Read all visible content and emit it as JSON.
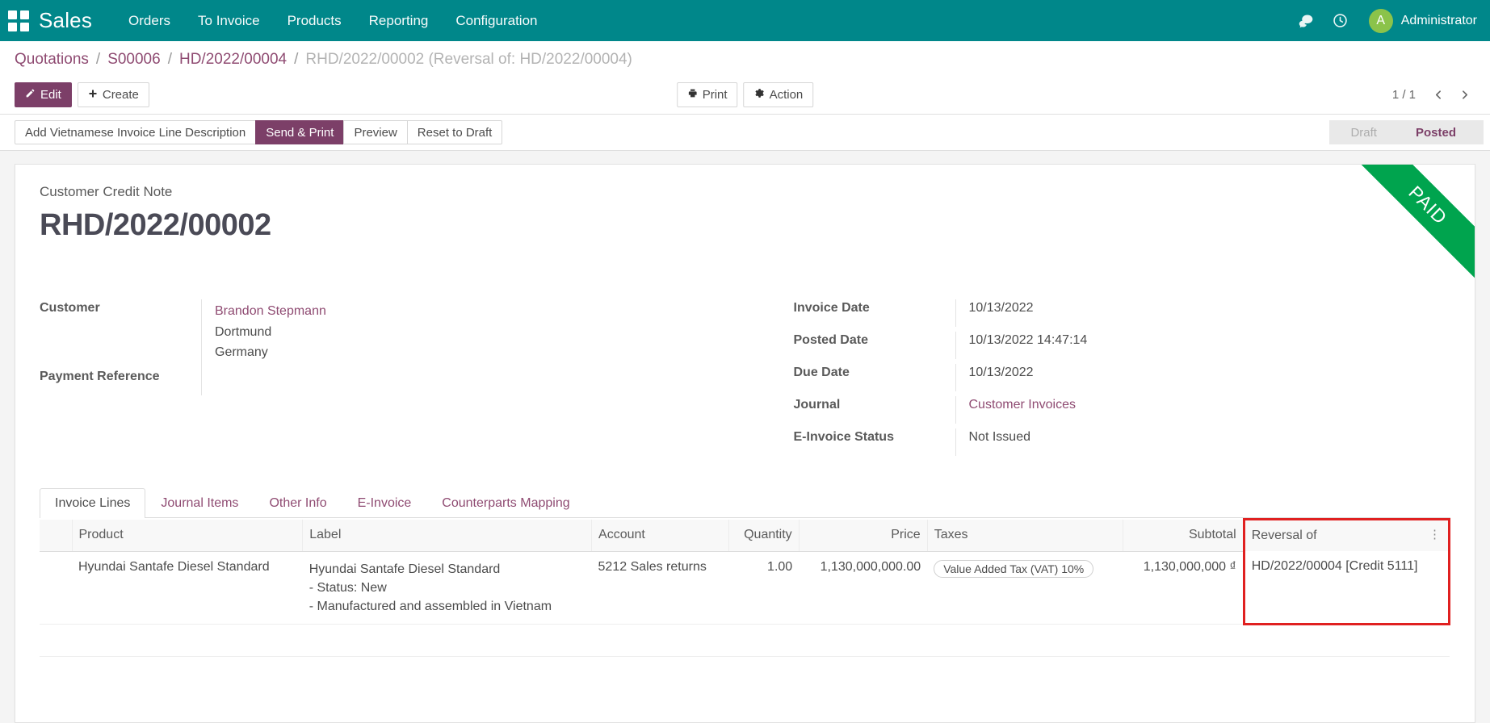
{
  "navbar": {
    "apps_icon": "apps-grid-icon",
    "brand": "Sales",
    "menu": [
      {
        "label": "Orders"
      },
      {
        "label": "To Invoice"
      },
      {
        "label": "Products"
      },
      {
        "label": "Reporting"
      },
      {
        "label": "Configuration"
      }
    ],
    "messages_icon": "messages-icon",
    "activities_icon": "clock-icon",
    "avatar_initial": "A",
    "user_name": "Administrator",
    "background_color": "#00878a",
    "avatar_color": "#8bc34a"
  },
  "breadcrumb": {
    "items": [
      {
        "label": "Quotations",
        "active": false
      },
      {
        "label": "S00006",
        "active": false
      },
      {
        "label": "HD/2022/00004",
        "active": false
      }
    ],
    "separator": "/",
    "current": "RHD/2022/00002 (Reversal of: HD/2022/00004)"
  },
  "controls": {
    "edit_label": "Edit",
    "create_label": "Create",
    "print_label": "Print",
    "action_label": "Action",
    "pager_value": "1 / 1",
    "prev_icon": "chevron-left-icon",
    "next_icon": "chevron-right-icon"
  },
  "statusbar_buttons": [
    {
      "label": "Add Vietnamese Invoice Line Description",
      "primary": false
    },
    {
      "label": "Send & Print",
      "primary": true
    },
    {
      "label": "Preview",
      "primary": false
    },
    {
      "label": "Reset to Draft",
      "primary": false
    }
  ],
  "statusbar": {
    "states": [
      {
        "label": "Draft",
        "active": false
      },
      {
        "label": "Posted",
        "active": true
      }
    ],
    "active_color": "#7c3f68"
  },
  "sheet": {
    "ribbon": "PAID",
    "ribbon_color": "#00a44e",
    "subtitle": "Customer Credit Note",
    "title": "RHD/2022/00002",
    "left_fields": [
      {
        "label": "Customer",
        "value_lines": [
          "Brandon Stepmann",
          "Dortmund",
          "Germany"
        ],
        "link_first": true
      },
      {
        "label": "Payment Reference",
        "value_lines": [],
        "link_first": false
      }
    ],
    "right_fields": [
      {
        "label": "Invoice Date",
        "value": "10/13/2022",
        "is_link": false
      },
      {
        "label": "Posted Date",
        "value": "10/13/2022 14:47:14",
        "is_link": false
      },
      {
        "label": "Due Date",
        "value": "10/13/2022",
        "is_link": false
      },
      {
        "label": "Journal",
        "value": "Customer Invoices",
        "is_link": true
      },
      {
        "label": "E-Invoice Status",
        "value": "Not Issued",
        "is_link": false
      }
    ]
  },
  "notebook": {
    "tabs": [
      {
        "label": "Invoice Lines",
        "active": true
      },
      {
        "label": "Journal Items",
        "active": false
      },
      {
        "label": "Other Info",
        "active": false
      },
      {
        "label": "E-Invoice",
        "active": false
      },
      {
        "label": "Counterparts Mapping",
        "active": false
      }
    ]
  },
  "lines_table": {
    "columns": [
      {
        "label": "Product",
        "align": "left"
      },
      {
        "label": "Label",
        "align": "left"
      },
      {
        "label": "Account",
        "align": "left"
      },
      {
        "label": "Quantity",
        "align": "right"
      },
      {
        "label": "Price",
        "align": "right"
      },
      {
        "label": "Taxes",
        "align": "left"
      },
      {
        "label": "Subtotal",
        "align": "right"
      },
      {
        "label": "Reversal of",
        "align": "left",
        "highlighted": true
      }
    ],
    "optional_columns_icon": "vertical-dots-icon",
    "rows": [
      {
        "product": "Hyundai Santafe Diesel Standard",
        "label_lines": [
          "Hyundai Santafe Diesel Standard",
          "- Status: New",
          "- Manufactured and assembled in Vietnam"
        ],
        "account": "5212 Sales returns",
        "quantity": "1.00",
        "price": "1,130,000,000.00",
        "taxes": "Value Added Tax (VAT) 10%",
        "subtotal": "1,130,000,000 ₫",
        "reversal_of": "HD/2022/00004 [Credit 5111]"
      }
    ],
    "highlight_color": "#e02020"
  }
}
